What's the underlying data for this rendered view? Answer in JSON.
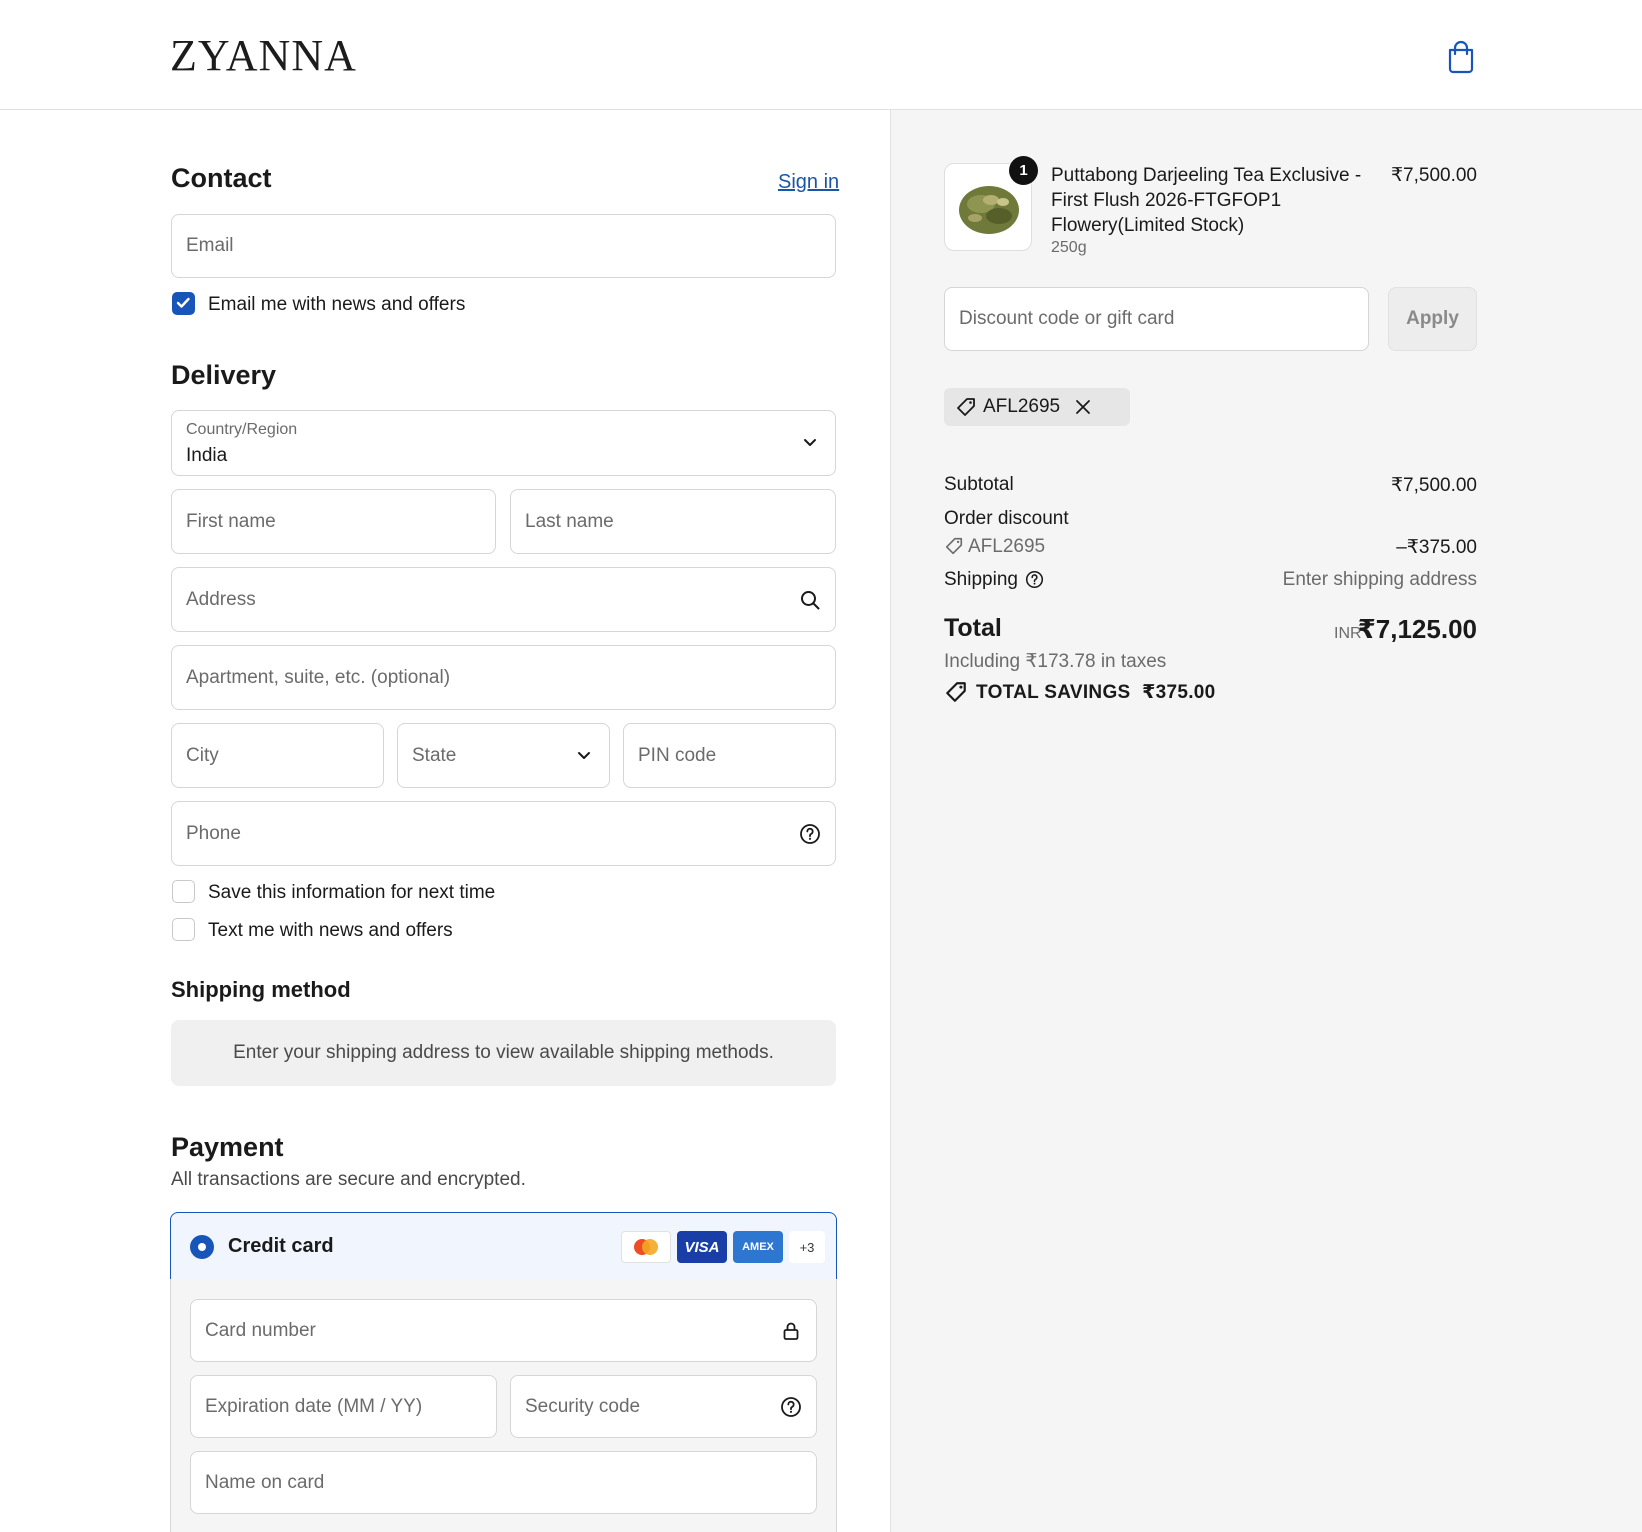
{
  "brand": {
    "logo_text": "ZYANNA"
  },
  "contact": {
    "heading": "Contact",
    "sign_in": "Sign in",
    "email_placeholder": "Email",
    "news_checkbox_label": "Email me with news and offers",
    "news_checked": true
  },
  "delivery": {
    "heading": "Delivery",
    "country_label": "Country/Region",
    "country_value": "India",
    "first_name_placeholder": "First name",
    "last_name_placeholder": "Last name",
    "address_placeholder": "Address",
    "apartment_placeholder": "Apartment, suite, etc. (optional)",
    "city_placeholder": "City",
    "state_placeholder": "State",
    "pin_placeholder": "PIN code",
    "phone_placeholder": "Phone",
    "save_info_label": "Save this information for next time",
    "text_me_label": "Text me with news and offers"
  },
  "shipping_method": {
    "heading": "Shipping method",
    "notice": "Enter your shipping address to view available shipping methods."
  },
  "payment": {
    "heading": "Payment",
    "subtitle": "All transactions are secure and encrypted.",
    "method_label": "Credit card",
    "card_brands": [
      "VISA",
      "AMEX"
    ],
    "more_brands": "+3",
    "card_number_placeholder": "Card number",
    "expiry_placeholder": "Expiration date (MM / YY)",
    "security_placeholder": "Security code",
    "name_placeholder": "Name on card"
  },
  "order": {
    "item": {
      "title": "Puttabong Darjeeling Tea Exclusive - First Flush 2026-FTGFOP1 Flowery(Limited Stock)",
      "variant": "250g",
      "price": "₹7,500.00",
      "quantity": "1"
    },
    "discount_placeholder": "Discount code or gift card",
    "apply_label": "Apply",
    "applied_code": "AFL2695",
    "subtotal_label": "Subtotal",
    "subtotal_value": "₹7,500.00",
    "order_discount_label": "Order discount",
    "order_discount_code": "AFL2695",
    "order_discount_value": "–₹375.00",
    "shipping_label": "Shipping",
    "shipping_value": "Enter shipping address",
    "total_label": "Total",
    "total_currency": "INR",
    "total_value": "₹7,125.00",
    "taxes_note": "Including ₹173.78 in taxes",
    "savings_label": "TOTAL SAVINGS",
    "savings_value": "₹375.00"
  },
  "colors": {
    "accent": "#1756b8",
    "link": "#1a56a8",
    "panel_bg": "#f5f5f5"
  }
}
